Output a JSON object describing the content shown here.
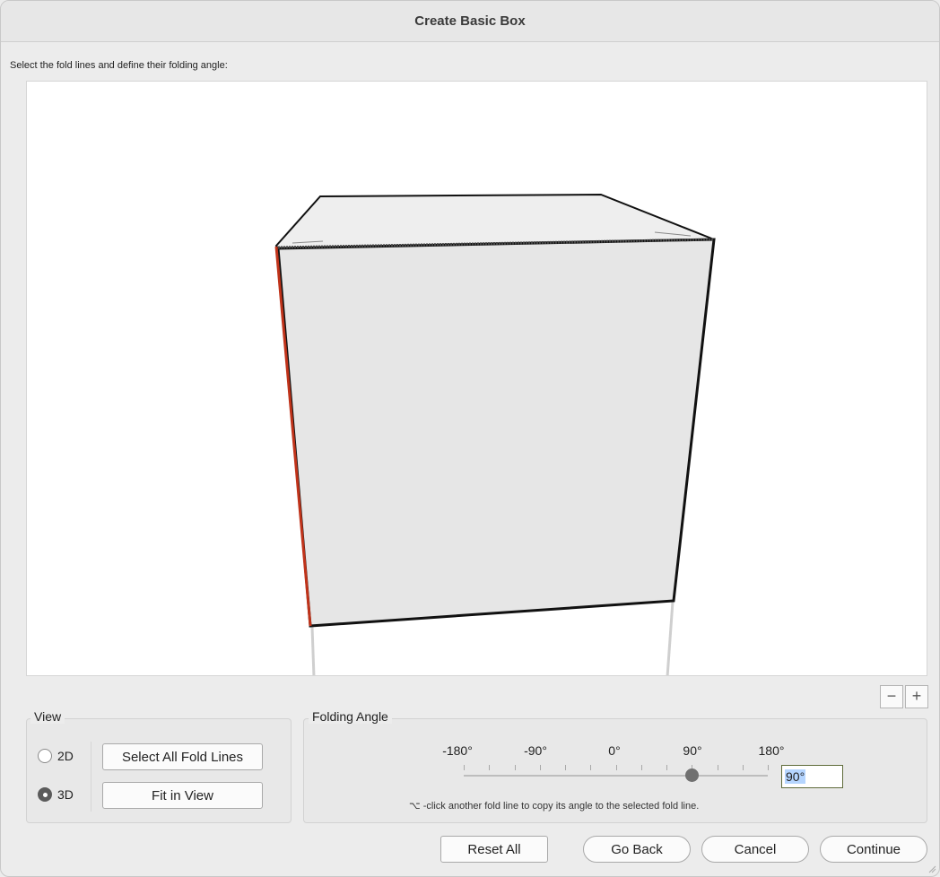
{
  "window": {
    "title": "Create Basic Box"
  },
  "instruction": "Select the fold lines and define their folding angle:",
  "zoom": {
    "minus": "−",
    "plus": "+"
  },
  "view": {
    "legend": "View",
    "option_2d": "2D",
    "option_3d": "3D",
    "selected": "3D",
    "select_all_label": "Select All Fold Lines",
    "fit_label": "Fit in View"
  },
  "folding_angle": {
    "legend": "Folding Angle",
    "tick_labels": [
      "-180°",
      "-90°",
      "0°",
      "90°",
      "180°"
    ],
    "value": "90°",
    "slider_min": -180,
    "slider_max": 180,
    "slider_value": 90,
    "hint": "⌥ -click another fold line to copy its angle to the selected fold line."
  },
  "footer": {
    "reset_label": "Reset All",
    "back_label": "Go Back",
    "cancel_label": "Cancel",
    "continue_label": "Continue"
  },
  "colors": {
    "selected_fold_line": "#c0331a",
    "box_face": "#e6e6e6"
  }
}
